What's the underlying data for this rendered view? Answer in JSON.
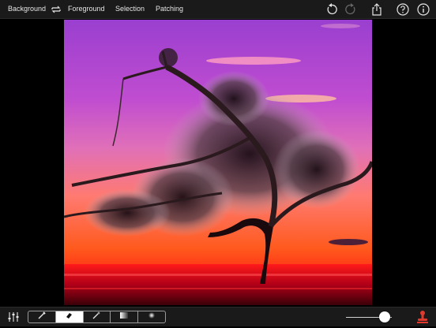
{
  "toolbar": {
    "background_label": "Background",
    "foreground_label": "Foreground",
    "selection_label": "Selection",
    "patching_label": "Patching"
  },
  "icons": {
    "swap": "swap-icon",
    "undo": "undo-icon",
    "redo": "redo-icon",
    "share": "share-icon",
    "help": "help-icon",
    "info": "info-icon",
    "adjust": "sliders-icon",
    "brush": "brush-icon",
    "eraser": "eraser-icon",
    "magic_wand": "magic-wand-icon",
    "gradient": "gradient-icon",
    "soft_brush": "soft-brush-icon",
    "stamp": "stamp-icon"
  },
  "brush_tools": {
    "active_index": 1
  },
  "brush_size": {
    "level": 0.85
  },
  "colors": {
    "bar_background": "#1a1a1a",
    "sky_top": "#9a3fd0",
    "sky_mid": "#d45cc4",
    "sunset": "#ff5a1e",
    "horizon": "#ff2a12",
    "stamp_accent": "#e03a2f"
  }
}
